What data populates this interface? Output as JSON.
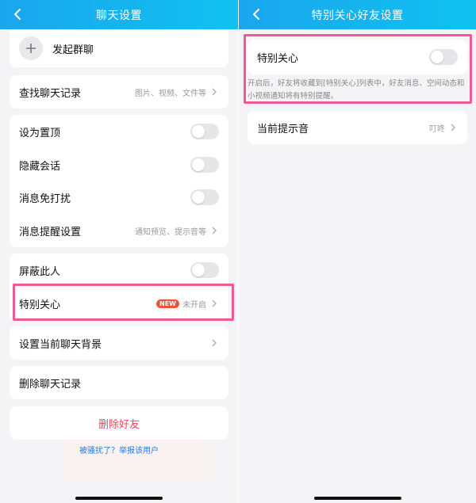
{
  "left": {
    "title": "聊天设置",
    "start_group_chat": "发起群聊",
    "search_history": {
      "label": "查找聊天记录",
      "hint": "图片、视频、文件等"
    },
    "pin": "设为置顶",
    "hide": "隐藏会话",
    "mute": "消息免打扰",
    "notify_settings": {
      "label": "消息提醒设置",
      "hint": "通知预览、提示音等"
    },
    "block": "屏蔽此人",
    "special_care": {
      "label": "特别关心",
      "badge": "NEW",
      "status": "未开启"
    },
    "chat_background": "设置当前聊天背景",
    "delete_history": "删除聊天记录",
    "delete_friend": "删除好友",
    "report": "被骚扰了？举报该用户"
  },
  "right": {
    "title": "特别关心好友设置",
    "special_care": "特别关心",
    "description": "开启后，好友将收藏到[特别关心]列表中，好友消息、空间动态和小视频通知将有特别提醒。",
    "ringtone": {
      "label": "当前提示音",
      "value": "叮咚"
    }
  },
  "colors": {
    "header": "#1aa6ee",
    "highlight": "#ee5b94",
    "danger": "#f0445c",
    "link": "#2d7ad8",
    "badge": "#f2503f"
  },
  "icons": [
    "back-arrow-icon",
    "plus-icon",
    "chevron-right-icon"
  ]
}
